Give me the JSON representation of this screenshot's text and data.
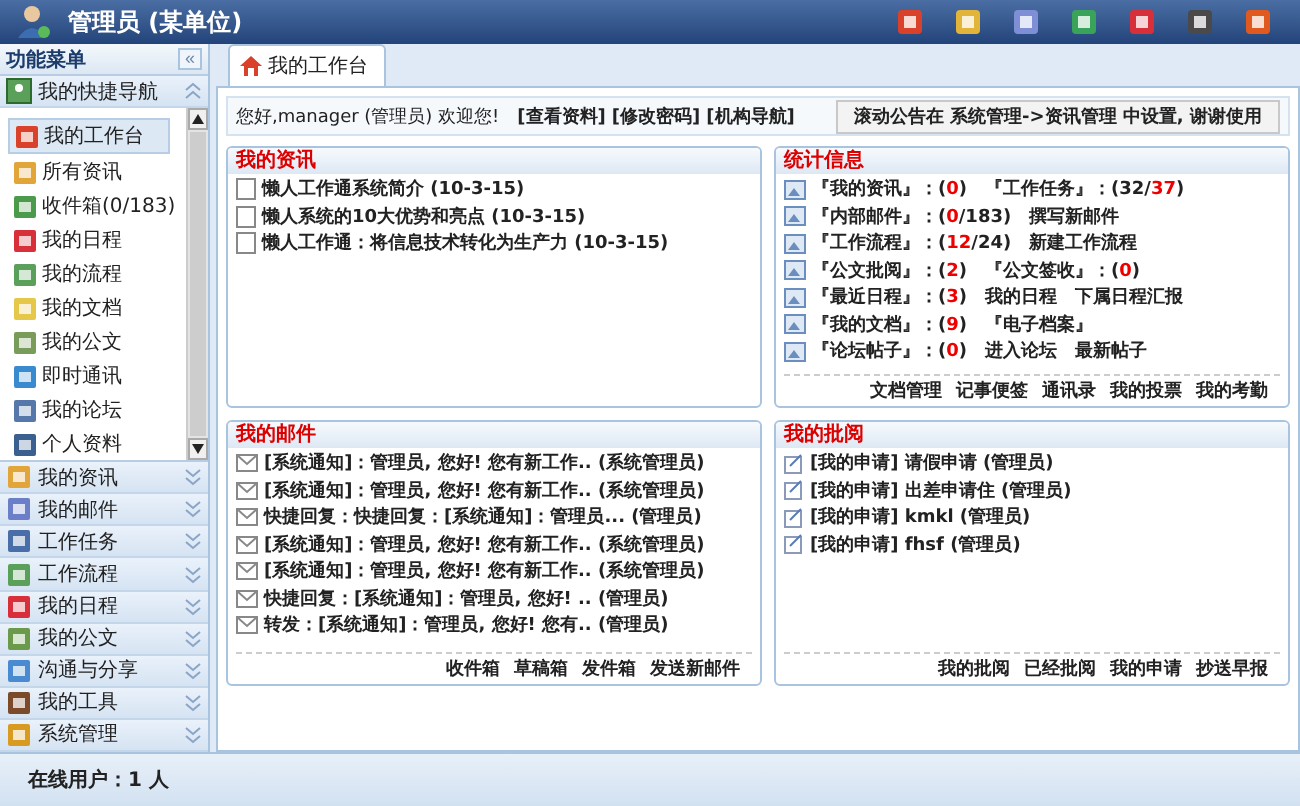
{
  "header": {
    "title": "管理员 (某单位)"
  },
  "sidebar": {
    "title": "功能菜单",
    "collapse": "«",
    "quick": {
      "label": "我的快捷导航",
      "expanded": true,
      "items": [
        {
          "label": "我的工作台",
          "selected": true
        },
        {
          "label": "所有资讯",
          "selected": false
        },
        {
          "label": "收件箱(0/183)",
          "selected": false
        },
        {
          "label": "我的日程",
          "selected": false
        },
        {
          "label": "我的流程",
          "selected": false
        },
        {
          "label": "我的文档",
          "selected": false
        },
        {
          "label": "我的公文",
          "selected": false
        },
        {
          "label": "即时通讯",
          "selected": false
        },
        {
          "label": "我的论坛",
          "selected": false
        },
        {
          "label": "个人资料",
          "selected": false
        }
      ]
    },
    "sections": [
      {
        "label": "我的资讯",
        "expanded": false
      },
      {
        "label": "我的邮件",
        "expanded": false
      },
      {
        "label": "工作任务",
        "expanded": false
      },
      {
        "label": "工作流程",
        "expanded": false
      },
      {
        "label": "我的日程",
        "expanded": false
      },
      {
        "label": "我的公文",
        "expanded": false
      },
      {
        "label": "沟通与分享",
        "expanded": false
      },
      {
        "label": "我的工具",
        "expanded": false
      },
      {
        "label": "系统管理",
        "expanded": false
      }
    ]
  },
  "tabs": [
    {
      "label": "我的工作台",
      "selected": true
    }
  ],
  "welcome": {
    "greeting": "您好,manager (管理员)  欢迎您!",
    "links": [
      "[查看资料]",
      "[修改密码]",
      "[机构导航]"
    ],
    "notice": "滚动公告在 系统管理->资讯管理 中设置, 谢谢使用"
  },
  "news": {
    "title": "我的资讯",
    "items": [
      "懒人工作通系统简介 (10-3-15)",
      "懒人系统的10大优势和亮点 (10-3-15)",
      "懒人工作通：将信息技术转化为生产力 (10-3-15)"
    ]
  },
  "stats": {
    "title": "统计信息",
    "rows": [
      {
        "groups": [
          [
            {
              "kind": "text",
              "text": "『我的资讯』：("
            },
            {
              "kind": "count",
              "text": "0"
            },
            {
              "kind": "text",
              "text": ")"
            }
          ],
          [
            {
              "kind": "text",
              "text": "『工作任务』：(32/"
            },
            {
              "kind": "count",
              "text": "37"
            },
            {
              "kind": "text",
              "text": ")"
            }
          ]
        ]
      },
      {
        "groups": [
          [
            {
              "kind": "text",
              "text": "『内部邮件』：("
            },
            {
              "kind": "count",
              "text": "0"
            },
            {
              "kind": "text",
              "text": "/183)"
            }
          ],
          [
            {
              "kind": "text",
              "text": "撰写新邮件"
            }
          ]
        ]
      },
      {
        "groups": [
          [
            {
              "kind": "text",
              "text": "『工作流程』：("
            },
            {
              "kind": "count",
              "text": "12"
            },
            {
              "kind": "text",
              "text": "/24)"
            }
          ],
          [
            {
              "kind": "text",
              "text": "新建工作流程"
            }
          ]
        ]
      },
      {
        "groups": [
          [
            {
              "kind": "text",
              "text": "『公文批阅』：("
            },
            {
              "kind": "count",
              "text": "2"
            },
            {
              "kind": "text",
              "text": ")"
            }
          ],
          [
            {
              "kind": "text",
              "text": "『公文签收』：("
            },
            {
              "kind": "count",
              "text": "0"
            },
            {
              "kind": "text",
              "text": ")"
            }
          ]
        ]
      },
      {
        "groups": [
          [
            {
              "kind": "text",
              "text": "『最近日程』：("
            },
            {
              "kind": "count",
              "text": "3"
            },
            {
              "kind": "text",
              "text": ")"
            }
          ],
          [
            {
              "kind": "text",
              "text": "我的日程"
            }
          ],
          [
            {
              "kind": "text",
              "text": "下属日程汇报"
            }
          ]
        ]
      },
      {
        "groups": [
          [
            {
              "kind": "text",
              "text": "『我的文档』：("
            },
            {
              "kind": "count",
              "text": "9"
            },
            {
              "kind": "text",
              "text": ")"
            }
          ],
          [
            {
              "kind": "text",
              "text": "『电子档案』"
            }
          ]
        ]
      },
      {
        "groups": [
          [
            {
              "kind": "text",
              "text": "『论坛帖子』：("
            },
            {
              "kind": "count",
              "text": "0"
            },
            {
              "kind": "text",
              "text": ")"
            }
          ],
          [
            {
              "kind": "text",
              "text": "进入论坛"
            }
          ],
          [
            {
              "kind": "text",
              "text": "最新帖子"
            }
          ]
        ]
      }
    ],
    "links": [
      "文档管理",
      "记事便签",
      "通讯录",
      "我的投票",
      "我的考勤"
    ]
  },
  "mail": {
    "title": "我的邮件",
    "items": [
      "[系统通知]：管理员, 您好! 您有新工作.. (系统管理员)",
      "[系统通知]：管理员, 您好! 您有新工作.. (系统管理员)",
      "快捷回复：快捷回复：[系统通知]：管理员... (管理员)",
      "[系统通知]：管理员, 您好! 您有新工作.. (系统管理员)",
      "[系统通知]：管理员, 您好! 您有新工作.. (系统管理员)",
      "快捷回复：[系统通知]：管理员, 您好! .. (管理员)",
      "转发：[系统通知]：管理员, 您好! 您有.. (管理员)"
    ],
    "links": [
      "收件箱",
      "草稿箱",
      "发件箱",
      "发送新邮件"
    ]
  },
  "approval": {
    "title": "我的批阅",
    "items": [
      "[我的申请] 请假申请 (管理员)",
      "[我的申请] 出差申请住 (管理员)",
      "[我的申请] kmkl (管理员)",
      "[我的申请] fhsf (管理员)"
    ],
    "links": [
      "我的批阅",
      "已经批阅",
      "我的申请",
      "抄送早报"
    ]
  },
  "footer": {
    "online": "在线用户：1 人"
  }
}
